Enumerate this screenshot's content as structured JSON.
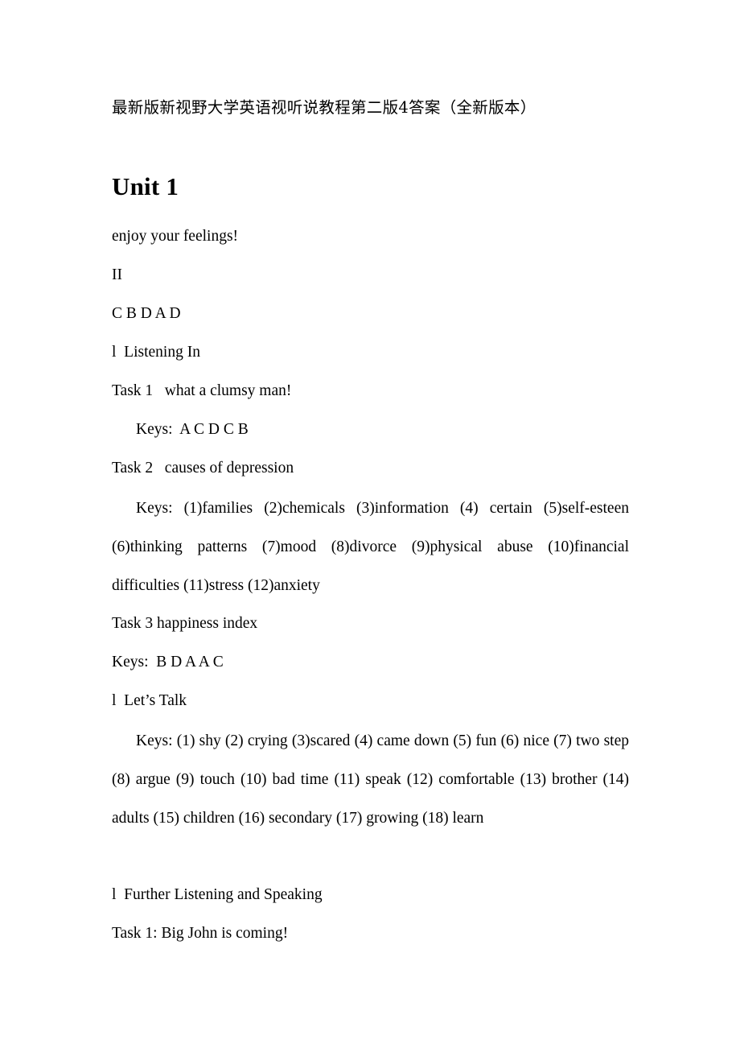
{
  "document": {
    "title_cjk": "最新版新视野大学英语视听说教程第二版4答案（全新版本）",
    "unit_heading": "Unit 1",
    "bullet_marker": "l",
    "background_color": "#ffffff",
    "text_color": "#000000"
  },
  "body": {
    "line_enjoy": "enjoy your feelings!",
    "line_ii": "II",
    "line_answers_cbdad": "C B D A D",
    "section_listening_in": "l  Listening In",
    "task1_title": "Task 1   what a clumsy man!",
    "task1_keys": "Keys:  A C D C B",
    "task2_title": "Task 2   causes of depression",
    "task2_keys": "Keys:  (1)families  (2)chemicals  (3)information  (4)  certain  (5)self-esteen  (6)thinking  patterns  (7)mood  (8)divorce  (9)physical  abuse (10)financial difficulties (11)stress (12)anxiety",
    "task3_title": "Task 3 happiness index",
    "task3_keys": "Keys:  B D A A C",
    "section_lets_talk": "l  Let’s Talk",
    "lets_talk_keys": "Keys: (1) shy (2) crying (3)scared (4) came down (5) fun (6) nice (7) two step (8) argue (9) touch (10) bad time (11) speak (12) comfortable (13) brother (14) adults (15) children (16) secondary (17) growing  (18) learn",
    "section_further_listening": "l  Further Listening and Speaking",
    "further_task1_title": "Task 1: Big John is coming!"
  }
}
